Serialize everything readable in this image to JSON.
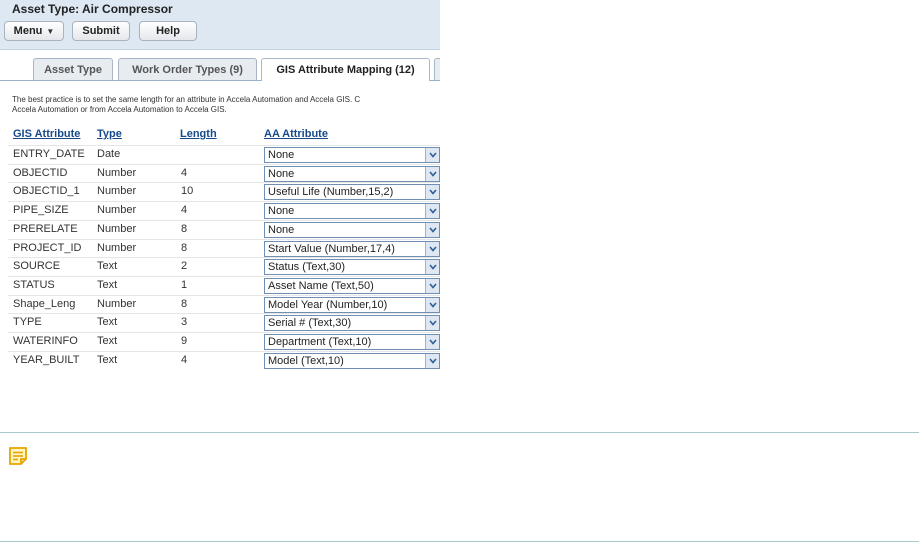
{
  "header": {
    "title": "Asset Type: Air Compressor"
  },
  "toolbar": {
    "menu_label": "Menu",
    "submit_label": "Submit",
    "help_label": "Help"
  },
  "tabs": [
    {
      "label": "Asset Type"
    },
    {
      "label": "Work Order Types (9)"
    },
    {
      "label": "GIS Attribute Mapping (12)",
      "active": true
    }
  ],
  "note_text": {
    "line1": "The best practice is to set the same length for an attribute in Accela Automation and Accela GIS. C",
    "line2": "Accela Automation or from Accela Automation to Accela GIS."
  },
  "table": {
    "headers": {
      "gis": "GIS Attribute",
      "type": "Type",
      "length": "Length",
      "aa": "AA Attribute"
    },
    "rows": [
      {
        "gis": "ENTRY_DATE",
        "type": "Date",
        "length": "",
        "aa": "None"
      },
      {
        "gis": "OBJECTID",
        "type": "Number",
        "length": "4",
        "aa": "None"
      },
      {
        "gis": "OBJECTID_1",
        "type": "Number",
        "length": "10",
        "aa": "Useful Life (Number,15,2)"
      },
      {
        "gis": "PIPE_SIZE",
        "type": "Number",
        "length": "4",
        "aa": "None"
      },
      {
        "gis": "PRERELATE",
        "type": "Number",
        "length": "8",
        "aa": "None"
      },
      {
        "gis": "PROJECT_ID",
        "type": "Number",
        "length": "8",
        "aa": "Start Value (Number,17,4)"
      },
      {
        "gis": "SOURCE",
        "type": "Text",
        "length": "2",
        "aa": "Status (Text,30)"
      },
      {
        "gis": "STATUS",
        "type": "Text",
        "length": "1",
        "aa": "Asset Name (Text,50)"
      },
      {
        "gis": "Shape_Leng",
        "type": "Number",
        "length": "8",
        "aa": "Model Year (Number,10)"
      },
      {
        "gis": "TYPE",
        "type": "Text",
        "length": "3",
        "aa": "Serial # (Text,30)"
      },
      {
        "gis": "WATERINFO",
        "type": "Text",
        "length": "9",
        "aa": "Department (Text,10)"
      },
      {
        "gis": "YEAR_BUILT",
        "type": "Text",
        "length": "4",
        "aa": "Model (Text,10)"
      }
    ]
  },
  "icons": {
    "dropdown": "chevron-down-icon",
    "note": "note-icon"
  },
  "colors": {
    "header_bg": "#dde8f3",
    "link": "#174a8b",
    "callout_border": "#a7c7cc",
    "note_icon": "#e9a400"
  }
}
